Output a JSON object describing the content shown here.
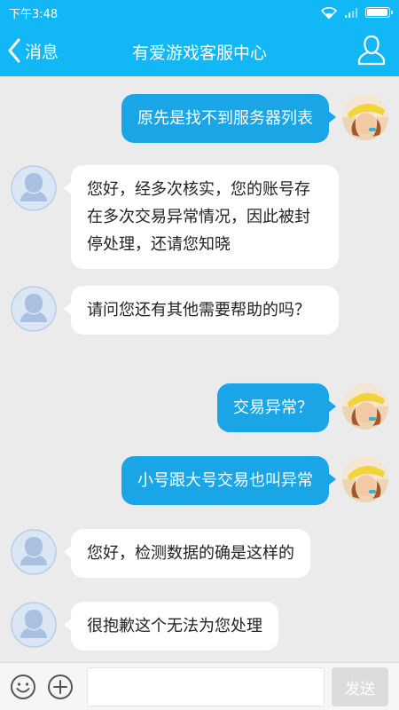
{
  "status_bar": {
    "time": "下午3:48",
    "icons": [
      "wifi-icon",
      "signal-icon",
      "battery-icon"
    ],
    "battery_level_percent": 95
  },
  "header": {
    "back_label": "消息",
    "title": "有爱游戏客服中心",
    "back_icon": "chevron-left-icon",
    "profile_icon": "person-outline-icon"
  },
  "messages": [
    {
      "side": "right",
      "text": "原先是找不到服务器列表"
    },
    {
      "side": "left",
      "text": "您好，经多次核实，您的账号存在多次交易异常情况，因此被封停处理，还请您知晓"
    },
    {
      "side": "left",
      "text": "请问您还有其他需要帮助的吗？"
    },
    {
      "side": "right",
      "text": "交易异常？"
    },
    {
      "side": "right",
      "text": "小号跟大号交易也叫异常"
    },
    {
      "side": "left",
      "text": "您好，检测数据的确是这样的"
    },
    {
      "side": "left",
      "text": "很抱歉这个无法为您处理"
    }
  ],
  "input_bar": {
    "value": "",
    "send_label": "发送",
    "emoji_icon": "smiley-icon",
    "plus_icon": "plus-circle-icon"
  },
  "colors": {
    "primary": "#12b7f5",
    "sent_bubble": "#1aa6e6",
    "received_bubble": "#ffffff",
    "chat_background": "#ebebeb",
    "send_button_disabled": "#dcdcdc"
  }
}
